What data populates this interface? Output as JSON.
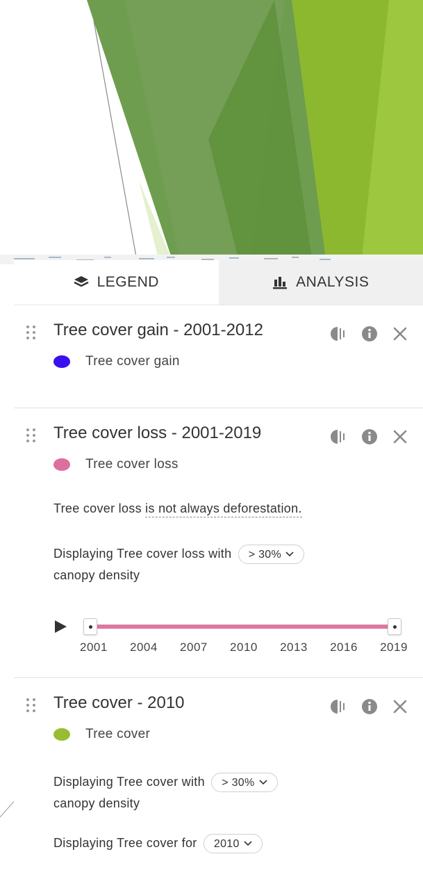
{
  "tabs": [
    {
      "label": "LEGEND",
      "icon": "layers-icon",
      "active": true
    },
    {
      "label": "ANALYSIS",
      "icon": "bar-chart-icon",
      "active": false
    }
  ],
  "layers": [
    {
      "title": "Tree cover gain - 2001-2012",
      "legend_label": "Tree cover gain",
      "color": "#3a0ff0"
    },
    {
      "title": "Tree cover loss - 2001-2019",
      "legend_label": "Tree cover loss",
      "color": "#dd6f9c",
      "note_prefix": "Tree cover loss ",
      "note_link": "is not always deforestation.",
      "density_prefix": "Displaying Tree cover loss with",
      "density_value": "> 30%",
      "density_suffix": "canopy density",
      "timeline": {
        "start": 2001,
        "end": 2019,
        "years": [
          "2001",
          "2004",
          "2007",
          "2010",
          "2013",
          "2016",
          "2019"
        ]
      }
    },
    {
      "title": "Tree cover - 2010",
      "legend_label": "Tree cover",
      "color": "#97be32",
      "density_prefix": "Displaying Tree cover with",
      "density_value": "> 30%",
      "density_suffix": "canopy density",
      "year_prefix": "Displaying Tree cover for",
      "year_value": "2010"
    }
  ],
  "tool_icons": [
    "opacity-icon",
    "info-icon",
    "close-icon"
  ],
  "colors": {
    "green_dark": "#5f8f3e",
    "green_mid": "#6f9e4c",
    "green_light": "#8cbf30",
    "green_lime": "#9ccb3d"
  }
}
